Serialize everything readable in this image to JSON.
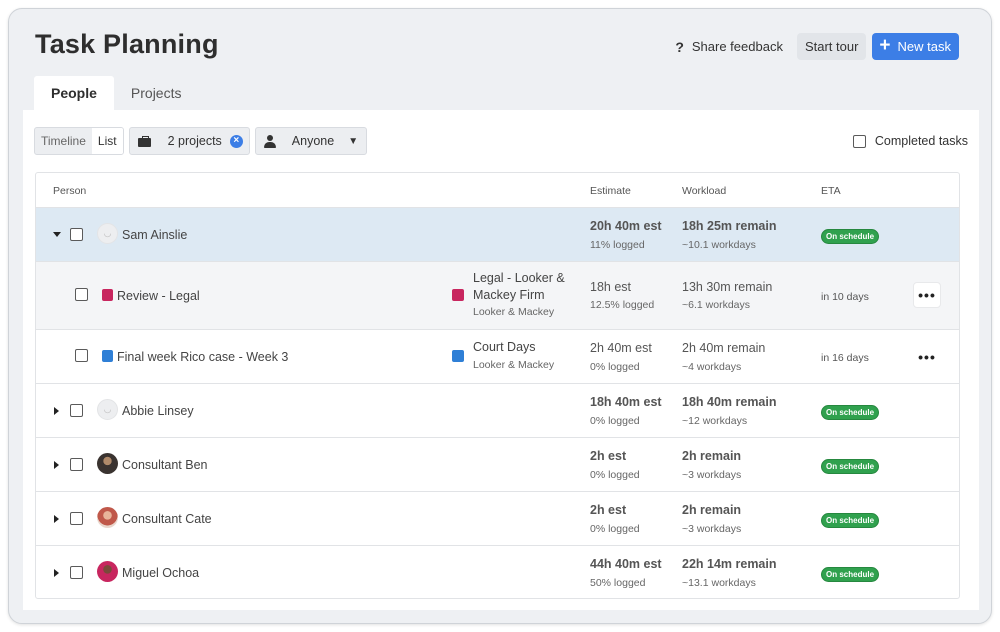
{
  "header": {
    "title": "Task Planning",
    "feedback_label": "Share feedback",
    "tour_label": "Start tour",
    "new_task_label": "New task"
  },
  "tabs": [
    {
      "label": "People",
      "active": true
    },
    {
      "label": "Projects",
      "active": false
    }
  ],
  "toolbar": {
    "view_timeline": "Timeline",
    "view_list": "List",
    "projects_filter": "2 projects",
    "assignee_filter": "Anyone",
    "completed_label": "Completed tasks"
  },
  "table": {
    "columns": {
      "person": "Person",
      "estimate": "Estimate",
      "workload": "Workload",
      "eta": "ETA"
    },
    "rows": [
      {
        "name": "Sam Ainslie",
        "estimate": "20h 40m est",
        "logged": "11% logged",
        "remain": "18h 25m remain",
        "workdays": "~10.1 workdays",
        "eta": "On schedule"
      },
      {
        "task": "Review - Legal",
        "project": "Legal - Looker & Mackey Firm",
        "project_line1": "Legal - Looker &",
        "project_line2": "Mackey Firm",
        "client": "Looker & Mackey",
        "estimate": "18h est",
        "logged": "12.5% logged",
        "remain": "13h 30m remain",
        "workdays": "~6.1 workdays",
        "eta": "in 10 days"
      },
      {
        "task": "Final week Rico case - Week 3",
        "project": "Court Days",
        "client": "Looker & Mackey",
        "estimate": "2h 40m est",
        "logged": "0% logged",
        "remain": "2h 40m remain",
        "workdays": "~4 workdays",
        "eta": "in 16 days"
      },
      {
        "name": "Abbie Linsey",
        "estimate": "18h 40m est",
        "logged": "0% logged",
        "remain": "18h 40m remain",
        "workdays": "~12 workdays",
        "eta": "On schedule"
      },
      {
        "name": "Consultant Ben",
        "estimate": "2h est",
        "logged": "0% logged",
        "remain": "2h remain",
        "workdays": "~3 workdays",
        "eta": "On schedule"
      },
      {
        "name": "Consultant Cate",
        "estimate": "2h est",
        "logged": "0% logged",
        "remain": "2h remain",
        "workdays": "~3 workdays",
        "eta": "On schedule"
      },
      {
        "name": "Miguel Ochoa",
        "estimate": "44h 40m est",
        "logged": "50% logged",
        "remain": "22h 14m remain",
        "workdays": "~13.1 workdays",
        "eta": "On schedule"
      }
    ]
  },
  "colors": {
    "accent": "#3c7ee6",
    "on_schedule": "#30a14e",
    "legal_project": "#c8265f",
    "court_project": "#2f7fd6",
    "selected_row": "#dde9f3"
  },
  "icons": [
    "question-icon",
    "plus-icon",
    "briefcase-icon",
    "clear-icon",
    "person-icon",
    "caret-down-icon",
    "expand-arrow-icon",
    "task-check-icon",
    "more-icon"
  ]
}
